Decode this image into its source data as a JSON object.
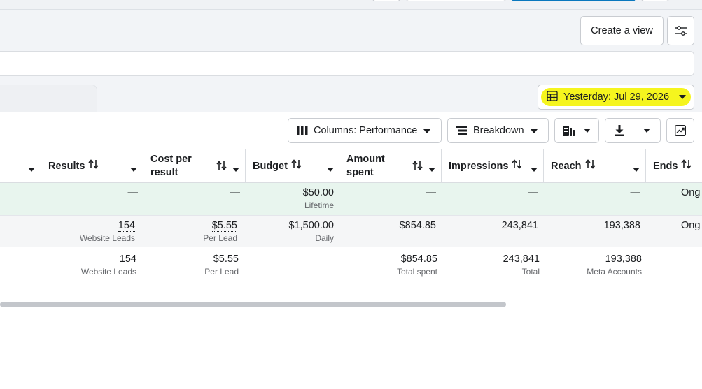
{
  "header": {
    "create_view_label": "Create a view",
    "settings_icon": "sliders-icon"
  },
  "date_filter": {
    "label": "Yesterday: Jul 29, 2026",
    "highlight_color": "#f5f51e"
  },
  "toolbar": {
    "columns_label": "Columns: Performance",
    "breakdown_label": "Breakdown"
  },
  "table": {
    "headers": {
      "results": "Results",
      "cost_per_result": "Cost per result",
      "budget": "Budget",
      "amount_spent": "Amount spent",
      "impressions": "Impressions",
      "reach": "Reach",
      "ends": "Ends"
    },
    "rows": [
      {
        "results": "—",
        "results_sub": "",
        "cost": "—",
        "cost_sub": "",
        "budget": "$50.00",
        "budget_sub": "Lifetime",
        "amount": "—",
        "amount_sub": "",
        "impressions": "—",
        "impressions_sub": "",
        "reach": "—",
        "reach_sub": "",
        "ends": "Ong"
      },
      {
        "results": "154",
        "results_sub": "Website Leads",
        "cost": "$5.55",
        "cost_sub": "Per Lead",
        "budget": "$1,500.00",
        "budget_sub": "Daily",
        "amount": "$854.85",
        "amount_sub": "",
        "impressions": "243,841",
        "impressions_sub": "",
        "reach": "193,388",
        "reach_sub": "",
        "ends": "Ong"
      }
    ],
    "totals": {
      "results": "154",
      "results_sub": "Website Leads",
      "cost": "$5.55",
      "cost_sub": "Per Lead",
      "amount": "$854.85",
      "amount_sub": "Total spent",
      "impressions": "243,841",
      "impressions_sub": "Total",
      "reach": "193,388",
      "reach_sub": "Meta Accounts"
    }
  },
  "colors": {
    "row_highlight": "#e8f5ee",
    "accent_blue": "#0a78be"
  }
}
